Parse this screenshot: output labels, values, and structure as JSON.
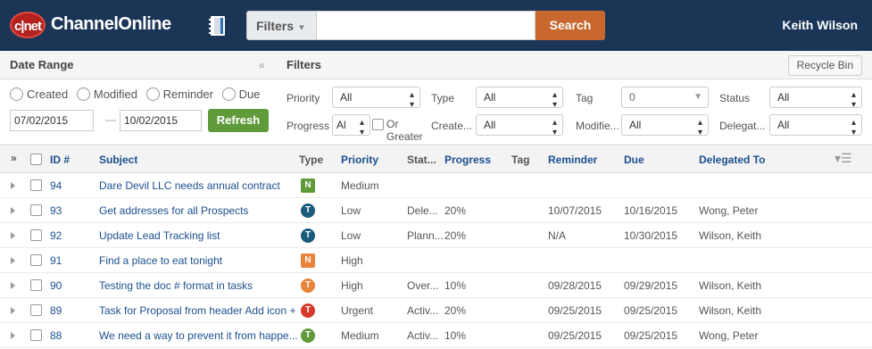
{
  "header": {
    "logo_badge": "c|net",
    "logo_text": "ChannelOnline",
    "filters_label": "Filters",
    "search_value": "",
    "search_label": "Search",
    "user_name": "Keith Wilson"
  },
  "date_panel": {
    "title": "Date Range",
    "radios": [
      "Created",
      "Modified",
      "Reminder",
      "Due"
    ],
    "from_date": "07/02/2015",
    "to_date": "10/02/2015",
    "dash": "—",
    "refresh_label": "Refresh"
  },
  "filters_panel": {
    "title": "Filters",
    "recycle_label": "Recycle Bin",
    "priority_label": "Priority",
    "priority_value": "All",
    "type_label": "Type",
    "type_value": "All",
    "tag_label": "Tag",
    "tag_value": "0",
    "status_label": "Status",
    "status_value": "All",
    "progress_label": "Progress",
    "progress_value": "Al",
    "or_greater_label": "Or",
    "or_greater_label2": "Greater",
    "created_label": "Create...",
    "created_value": "All",
    "modified_label": "Modifie...",
    "modified_value": "All",
    "delegated_label": "Delegat...",
    "delegated_value": "All"
  },
  "grid": {
    "columns": {
      "id": "ID #",
      "subject": "Subject",
      "type": "Type",
      "priority": "Priority",
      "status": "Stat...",
      "progress": "Progress",
      "tag": "Tag",
      "reminder": "Reminder",
      "due": "Due",
      "delegated": "Delegated To"
    },
    "rows": [
      {
        "id": "94",
        "subject": "Dare Devil LLC needs annual contract",
        "type": "N",
        "type_color": "#5f9b3a",
        "type_shape": "square",
        "priority": "Medium",
        "status": "",
        "progress": "",
        "reminder": "",
        "due": "",
        "delegated": ""
      },
      {
        "id": "93",
        "subject": "Get addresses for all Prospects",
        "type": "T",
        "type_color": "#1a5a7a",
        "type_shape": "circle",
        "priority": "Low",
        "status": "Dele...",
        "progress": "20%",
        "reminder": "10/07/2015",
        "due": "10/16/2015",
        "delegated": "Wong, Peter"
      },
      {
        "id": "92",
        "subject": "Update Lead Tracking list",
        "type": "T",
        "type_color": "#1a5a7a",
        "type_shape": "circle",
        "priority": "Low",
        "status": "Plann...",
        "progress": "20%",
        "reminder": "N/A",
        "due": "10/30/2015",
        "delegated": "Wilson, Keith"
      },
      {
        "id": "91",
        "subject": "Find a place to eat tonight",
        "type": "N",
        "type_color": "#e8843c",
        "type_shape": "square",
        "priority": "High",
        "status": "",
        "progress": "",
        "reminder": "",
        "due": "",
        "delegated": ""
      },
      {
        "id": "90",
        "subject": "Testing the doc # format in tasks",
        "type": "T",
        "type_color": "#e8843c",
        "type_shape": "circle",
        "priority": "High",
        "status": "Over...",
        "progress": "10%",
        "reminder": "09/28/2015",
        "due": "09/29/2015",
        "delegated": "Wilson, Keith"
      },
      {
        "id": "89",
        "subject": "Task for Proposal from header Add icon +",
        "type": "T",
        "type_color": "#d83a2a",
        "type_shape": "circle",
        "priority": "Urgent",
        "status": "Activ...",
        "progress": "20%",
        "reminder": "09/25/2015",
        "due": "09/25/2015",
        "delegated": "Wilson, Keith"
      },
      {
        "id": "88",
        "subject": "We need a way to prevent it from happe...",
        "type": "T",
        "type_color": "#5f9b3a",
        "type_shape": "circle",
        "priority": "Medium",
        "status": "Activ...",
        "progress": "10%",
        "reminder": "09/25/2015",
        "due": "09/25/2015",
        "delegated": "Wong, Peter"
      }
    ]
  }
}
